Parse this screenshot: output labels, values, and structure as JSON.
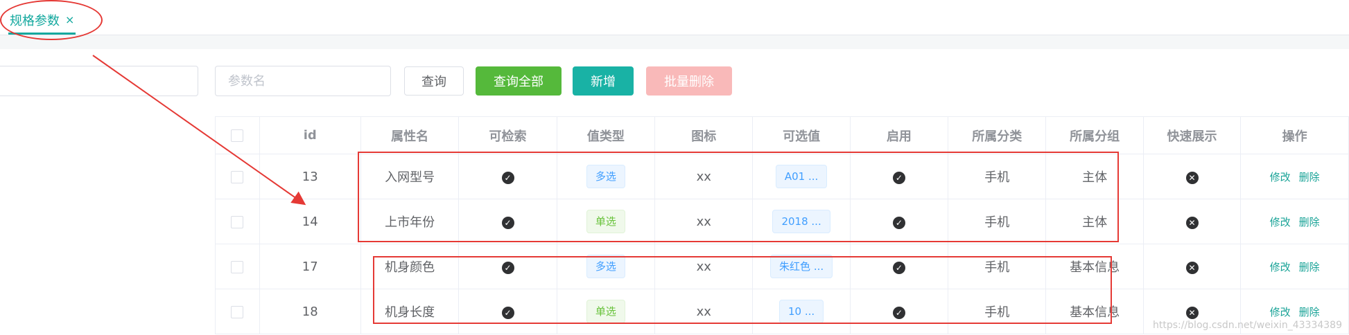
{
  "tab": {
    "label": "规格参数",
    "close_icon": "×"
  },
  "search": {
    "placeholder": "参数名"
  },
  "toolbar": {
    "query_label": "查询",
    "query_all_label": "查询全部",
    "add_label": "新增",
    "batch_delete_label": "批量删除"
  },
  "table": {
    "headers": [
      "id",
      "属性名",
      "可检索",
      "值类型",
      "图标",
      "可选值",
      "启用",
      "所属分类",
      "所属分组",
      "快速展示",
      "操作"
    ],
    "rows": [
      {
        "id": "13",
        "name": "入网型号",
        "value_type": "多选",
        "value_type_kind": "multi",
        "icon": "xx",
        "options": "A01 ...",
        "category": "手机",
        "group": "主体"
      },
      {
        "id": "14",
        "name": "上市年份",
        "value_type": "单选",
        "value_type_kind": "single",
        "icon": "xx",
        "options": "2018 ...",
        "category": "手机",
        "group": "主体"
      },
      {
        "id": "17",
        "name": "机身颜色",
        "value_type": "多选",
        "value_type_kind": "multi",
        "icon": "xx",
        "options": "朱红色 ...",
        "category": "手机",
        "group": "基本信息"
      },
      {
        "id": "18",
        "name": "机身长度",
        "value_type": "单选",
        "value_type_kind": "single",
        "icon": "xx",
        "options": "10 ...",
        "category": "手机",
        "group": "基本信息"
      }
    ],
    "actions": {
      "edit": "修改",
      "delete": "删除"
    }
  },
  "icons": {
    "searchable": "check-circle-icon",
    "enabled": "check-circle-icon",
    "quick_show": "x-circle-icon"
  },
  "colors": {
    "accent": "#13a89e",
    "annotation": "#e53935",
    "query_all": "#55b93b",
    "add": "#19b2a5",
    "batch_delete_disabled": "#f9b9b9"
  },
  "watermark": "https://blog.csdn.net/weixin_43334389"
}
